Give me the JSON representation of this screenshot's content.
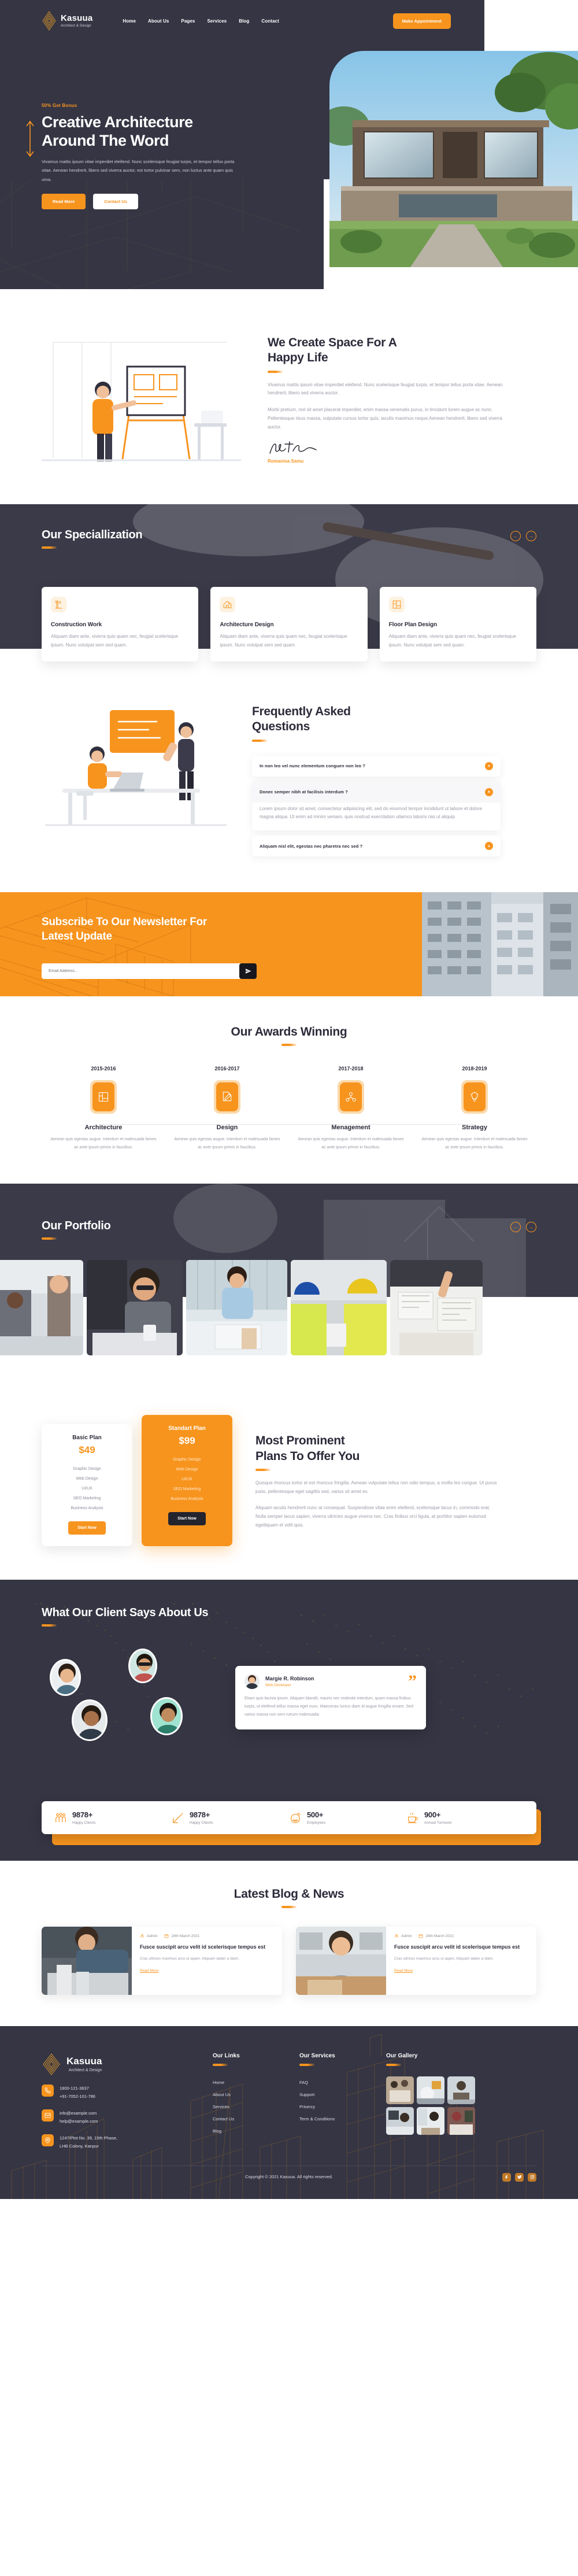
{
  "brand": {
    "name": "Kasuua",
    "tagline": "Architect & Design"
  },
  "colors": {
    "accent": "#f7941e",
    "dark": "#353544",
    "text": "#2b2b3a",
    "muted": "#9a9aa6"
  },
  "nav": {
    "items": [
      "Home",
      "About Us",
      "Pages",
      "Services",
      "Blog",
      "Contact"
    ],
    "cta": "Make Appointment"
  },
  "hero": {
    "kicker": "50% Get Bonus",
    "title_line1": "Creative Architecture",
    "title_line2": "Around The Word",
    "paragraph": "Vivamus mattis ipsum vitae imperdiet eleifend. Nunc scelerisque feugiat turpis, et tempor tellus porta vitae. Aenean hendrerit, libero sed viverra auctor, est tortor pulvinar sem, non luctus ante quam quis urna.",
    "btn_primary": "Read More",
    "btn_secondary": "Contact Us"
  },
  "about": {
    "title_line1": "We Create Space For A",
    "title_line2": "Happy Life",
    "paragraph1": "Vivamus mattis ipsum vitae imperdiet eleifend. Nunc scelerisque feugiat turpis, et tempor tellus porta vitae. Aenean hendrerit, libero sed viverra auctor.",
    "paragraph2": "Morbi pretium, nisl sit amet placerat imperdiet, enim massa venenatis purus, in tincidunt lorem augue ac nunc. Pellentesque risus massa, vulputate cursus tortor quis, iaculis maximus neque.Aenean hendrerit, libero sed viverra auctor.",
    "signature_name": "Romanisa Samu"
  },
  "specialization": {
    "title": "Our Speciallization",
    "prev_label": "←",
    "next_label": "→",
    "cards": [
      {
        "icon": "crane-icon",
        "title": "Construction Work",
        "desc": "Aliquam diam ante, viverra quis quam nec, feugiat scelerisque ipsum. Nunc volutpat sem sed quam."
      },
      {
        "icon": "house-pencil-icon",
        "title": "Architecture Design",
        "desc": "Aliquam diam ante, viverra quis quam nec, feugiat scelerisque ipsum. Nunc volutpat sem sed quam."
      },
      {
        "icon": "floorplan-icon",
        "title": "Floor Plan Design",
        "desc": "Aliquam diam ante, viverra quis quam nec, feugiat scelerisque ipsum. Nunc volutpat sem sed quam."
      }
    ]
  },
  "faq": {
    "title_line1": "Frequently Asked",
    "title_line2": "Questions",
    "items": [
      {
        "question": "In non leo vel nunc elementum conguen non leo ?",
        "toggle": "+",
        "open": false,
        "answer": ""
      },
      {
        "question": "Donec semper nibh at facilisis interdum ?",
        "toggle": "×",
        "open": true,
        "answer": "Lorem ipsum dolor sit amet, consectetur adipisicing elit, sed do eiusmod tempor incididunt ut labore et dolore magna aliqua. Ut enim ad minim veniam, quis nostrud exercitation ullamco laboris nisi ut aliquip"
      },
      {
        "question": "Aliquam nisl elit, egestas nec pharetra nec sed ?",
        "toggle": "+",
        "open": false,
        "answer": ""
      }
    ]
  },
  "newsletter": {
    "title_line1": "Subscribe To Our Newsletter For",
    "title_line2": "Latest Update",
    "placeholder": "Email Address...",
    "submit_icon": "send-icon"
  },
  "awards": {
    "title": "Our Awards Winning",
    "items": [
      {
        "year": "2015-2016",
        "icon": "blueprint-icon",
        "name": "Architecture",
        "desc": "Aenean quis egestas augue. Interdum et malesuada fames ac ante ipsum primis in faucibus."
      },
      {
        "year": "2016-2017",
        "icon": "design-pen-icon",
        "name": "Design",
        "desc": "Aenean quis egestas augue. Interdum et malesuada fames ac ante ipsum primis in faucibus."
      },
      {
        "year": "2017-2018",
        "icon": "management-icon",
        "name": "Menagement",
        "desc": "Aenean quis egestas augue. Interdum et malesuada fames ac ante ipsum primis in faucibus."
      },
      {
        "year": "2018-2019",
        "icon": "bulb-icon",
        "name": "Strategy",
        "desc": "Aenean quis egestas augue. Interdum et malesuada fames ac ante ipsum primis in faucibus."
      }
    ]
  },
  "portfolio": {
    "title": "Our Portfolio",
    "prev_label": "←",
    "next_label": "→",
    "items": [
      {
        "alt": "two-colleagues-reviewing-plans"
      },
      {
        "alt": "architect-with-coffee-and-model"
      },
      {
        "alt": "architect-building-scale-model"
      },
      {
        "alt": "construction-workers-with-helmets"
      },
      {
        "alt": "hands-sketching-floor-plans"
      }
    ]
  },
  "pricing": {
    "title_line1": "Most Prominent",
    "title_line2": "Plans To Offer You",
    "paragraph1": "Quisque rhoncus tortor et est rhoncus fringilla. Aenean vulputate tellus non odio tempus, a mollis leo congue. Ut purus justo, pellentesque eget sagittis sed, varius sit amet ex.",
    "paragraph2": "Aliquam iaculis hendrerit nunc at consequat. Suspendisse vitae enim eleifend, scelerisque lacus in, commodo erat. Nulla semper lacus sapien, viverra ultricies augue viverra nec. Cras finibus orci ligula, at porttitor sapien euismod egetliquam et velit quis.",
    "plans": [
      {
        "name": "Basic Plan",
        "price": "$49",
        "features": [
          "Graphic Design",
          "Web Design",
          "UI/UX",
          "SEO Marketing",
          "Business Analysis"
        ],
        "cta": "Start Now"
      },
      {
        "name": "Standart Plan",
        "price": "$99",
        "features": [
          "Graphic Design",
          "Web Design",
          "UI/UX",
          "SEO Marketing",
          "Business Analysis"
        ],
        "cta": "Start Now"
      }
    ]
  },
  "testimonials": {
    "title": "What Our Client Says About Us",
    "quote": {
      "name": "Margie R. Robinson",
      "role": "Web Developer",
      "text": "Etiam quis lacinia ipsum. Aliquam blandit, mauris nec molestie interdum, quam massa finibus turpis, ut eleifend tellus massa eget nunc. Maecenas luctus diam id augue fringilla ornare. Sed varius massa non sem rutrum malesuada.",
      "quote_mark": "”"
    },
    "avatars": [
      {
        "alt": "client-avatar-1"
      },
      {
        "alt": "client-avatar-2"
      },
      {
        "alt": "client-avatar-3"
      },
      {
        "alt": "client-avatar-4"
      },
      {
        "alt": "client-avatar-5"
      }
    ]
  },
  "stats": [
    {
      "icon": "people-icon",
      "value": "9878+",
      "label": "Happy Clients"
    },
    {
      "icon": "ruler-icon",
      "value": "9878+",
      "label": "Happy Clients"
    },
    {
      "icon": "smile-icon",
      "value": "500+",
      "label": "Employees"
    },
    {
      "icon": "coffee-icon",
      "value": "900+",
      "label": "Annual Turnover"
    }
  ],
  "blog": {
    "title": "Latest Blog & News",
    "posts": [
      {
        "author": "Admin",
        "date": "24th March 2021",
        "title": "Fusce suscipit arcu velit id scelerisque tempus est",
        "excerpt": "Cras ultrices maximus arcu ut aqam. Aliquam daber a diam.",
        "read_more": "Read More",
        "image_alt": "craftsman-building-architectural-model"
      },
      {
        "author": "Admin",
        "date": "24th March 2021",
        "title": "Fusce suscipit arcu velit id scelerisque tempus est",
        "excerpt": "Cras ultrices maximus arcu ut aqam. Aliquam daber a diam.",
        "read_more": "Read More",
        "image_alt": "smiling-woman-in-office"
      }
    ]
  },
  "footer": {
    "phones": [
      "1800-121-3637",
      "+91-7052-101-786"
    ],
    "emails": [
      "info@example.com",
      "help@example.com"
    ],
    "address_line1": "1247/Plot No. 39, 15th Phase,",
    "address_line2": "LHB Colony, Kanpur",
    "links_title": "Our Links",
    "links": [
      "Home",
      "About Us",
      "Services",
      "Contact Us",
      "Blog"
    ],
    "services_title": "Our Services",
    "services": [
      "FAQ",
      "Support",
      "Privercy",
      "Term & Conditions"
    ],
    "gallery_title": "Our Gallery",
    "gallery": [
      {
        "alt": "team-meeting-top-view"
      },
      {
        "alt": "workers-with-helmet"
      },
      {
        "alt": "man-at-desk"
      },
      {
        "alt": "designer-at-workstation"
      },
      {
        "alt": "man-with-laptop-window"
      },
      {
        "alt": "woman-typing-on-laptop"
      }
    ],
    "copyright": "Copyright © 2021 Kasuua. All rights reserved.",
    "socials": [
      "facebook-icon",
      "twitter-icon",
      "instagram-icon"
    ]
  }
}
